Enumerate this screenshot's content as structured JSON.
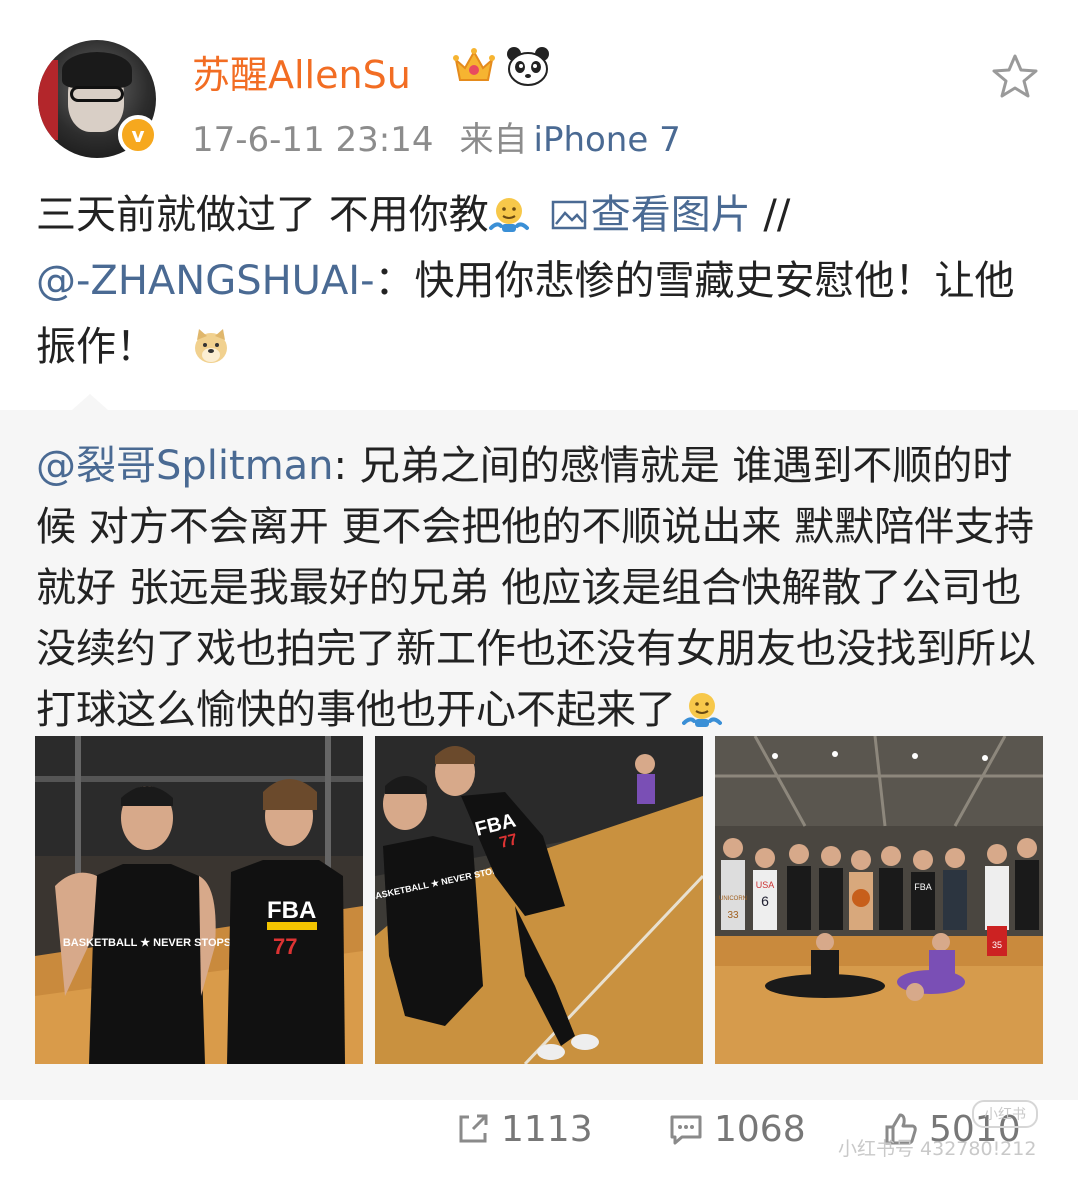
{
  "post": {
    "author": "苏醒AllenSu",
    "timestamp": "17-6-11 23:14",
    "source_prefix": "来自",
    "source_device": "iPhone 7",
    "verified_badge": "v",
    "favorite_icon": "star-outline-icon",
    "text_part1": "三天前就做过了 不用你教",
    "view_images": "查看图片",
    "separator": " //",
    "mention": "@-ZHANGSHUAI-",
    "text_part2": "：快用你悲惨的雪藏史安慰他！让他振作！"
  },
  "repost": {
    "mention": "@裂哥Splitman",
    "text": ": 兄弟之间的感情就是 谁遇到不顺的时候 对方不会离开 更不会把他的不顺说出来 默默陪伴支持就好 张远是我最好的兄弟 他应该是组合快解散了公司也没续约了戏也拍完了新工作也还没有女朋友也没找到所以打球这么愉快的事他也开心不起来了",
    "images": [
      {
        "jersey_left": "BASKETBALL ★ NEVER STOPS",
        "jersey_right": "FBA",
        "number": "77"
      },
      {
        "jersey_left": "BASKETBALL ★ NEVER STOPS",
        "jersey_right": "FBA",
        "number": "77"
      },
      {
        "jersey_a": "USA",
        "number_a": "6",
        "jersey_b": "FBA",
        "number_c": "35",
        "jersey_d": "UNICORN",
        "number_d": "33"
      }
    ]
  },
  "actions": {
    "repost_count": "1113",
    "comment_count": "1068",
    "like_count": "5010"
  },
  "watermark": {
    "text": "小红书号 432780!212",
    "logo": "小红书"
  },
  "colors": {
    "username": "#f26d23",
    "link": "#4a6a93",
    "meta": "#8c8c8c",
    "repost_bg": "#f6f6f6"
  }
}
